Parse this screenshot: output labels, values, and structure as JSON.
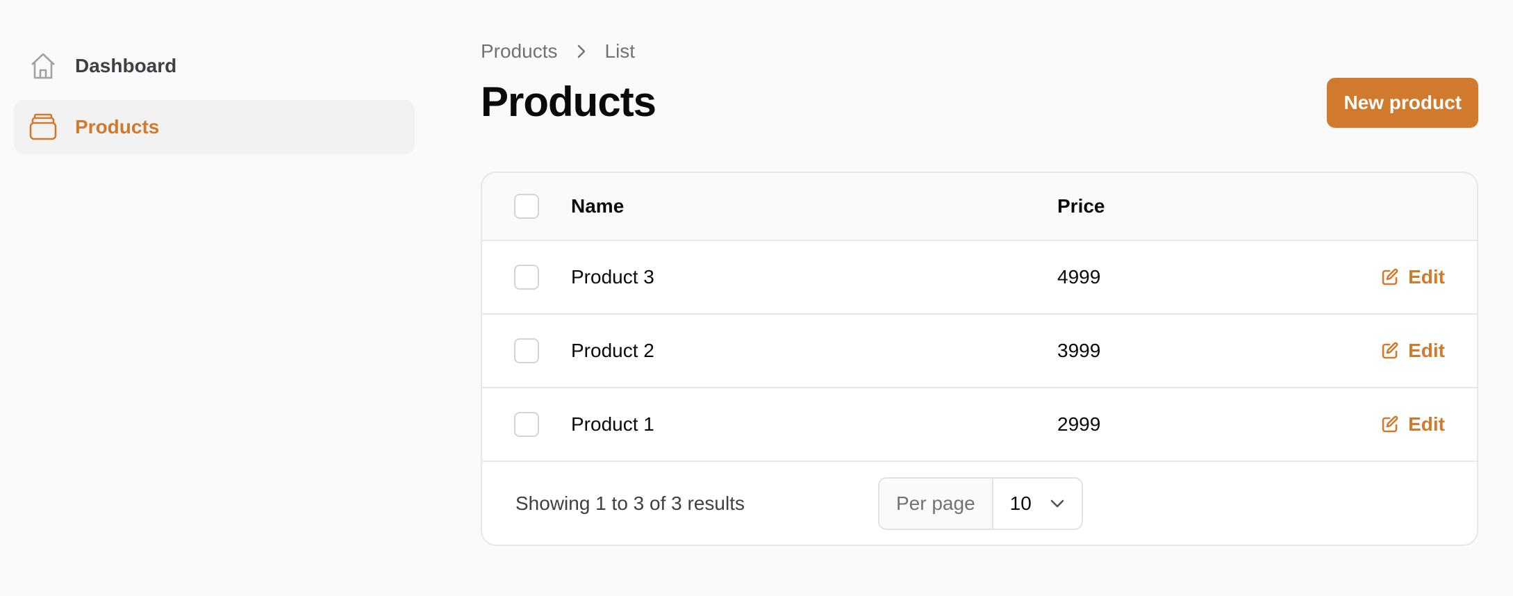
{
  "sidebar": {
    "items": [
      {
        "label": "Dashboard",
        "icon": "home-icon",
        "active": false
      },
      {
        "label": "Products",
        "icon": "stack-icon",
        "active": true
      }
    ]
  },
  "breadcrumb": {
    "items": [
      "Products",
      "List"
    ]
  },
  "header": {
    "title": "Products",
    "new_button_label": "New product"
  },
  "table": {
    "columns": {
      "name": "Name",
      "price": "Price"
    },
    "rows": [
      {
        "name": "Product 3",
        "price": "4999",
        "action": "Edit"
      },
      {
        "name": "Product 2",
        "price": "3999",
        "action": "Edit"
      },
      {
        "name": "Product 1",
        "price": "2999",
        "action": "Edit"
      }
    ]
  },
  "footer": {
    "showing": "Showing 1 to 3 of 3 results",
    "per_page_label": "Per page",
    "per_page_value": "10"
  },
  "colors": {
    "accent": "#d07a2d",
    "background": "#fafafa",
    "border": "#e7e7e7"
  }
}
